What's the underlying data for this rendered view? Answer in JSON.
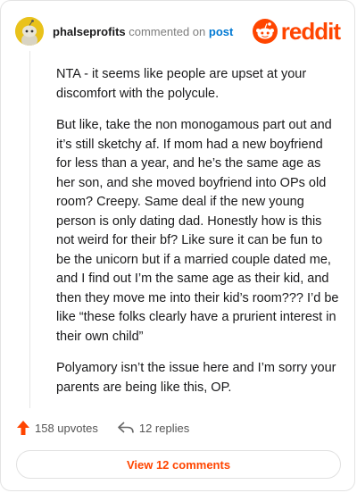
{
  "header": {
    "username": "phalseprofits",
    "action_text": "commented on",
    "post_link": "post",
    "brand": "reddit"
  },
  "comment": {
    "paragraphs": [
      "NTA - it seems like people are upset at your discomfort with the polycule.",
      "But like, take the non monogamous part out and it’s still sketchy af. If mom had a new boyfriend for less than a year, and he’s the same age as her son, and she moved boyfriend into OPs old room? Creepy. Same deal if the new young person is only dating dad. Honestly how is this not weird for their bf? Like sure it can be fun to be the unicorn but if a married couple dated me, and I find out I’m the same age as their kid, and then they move me into their kid’s room??? I’d be like “these folks clearly have a prurient interest in their own child”",
      "Polyamory isn’t the issue here and I’m sorry your parents are being like this, OP."
    ]
  },
  "actions": {
    "upvotes": "158 upvotes",
    "replies": "12 replies",
    "view_comments": "View 12 comments"
  },
  "colors": {
    "brand": "#ff4500",
    "link": "#0079d3",
    "avatar": "#e9c21b"
  },
  "icons": {
    "avatar": "snoo-avatar-icon",
    "logo": "reddit-logo-icon",
    "upvote": "upvote-arrow-icon",
    "reply": "reply-arrow-icon"
  }
}
